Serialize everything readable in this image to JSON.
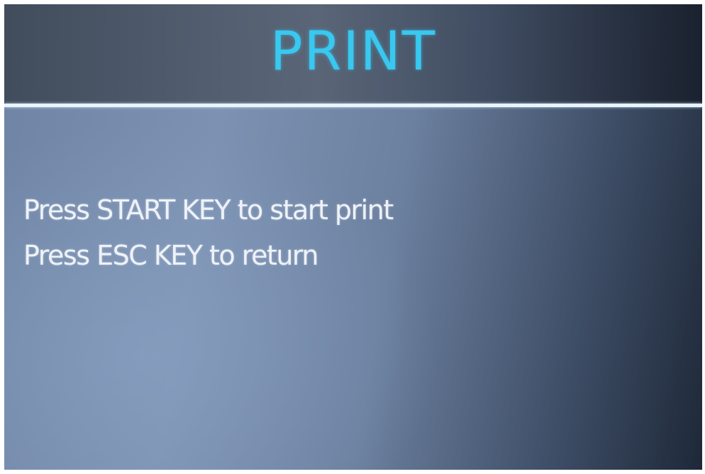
{
  "screen": {
    "title": "PRINT",
    "messages": [
      "Press START KEY to start print",
      "Press ESC KEY to return"
    ]
  },
  "colors": {
    "title": "#38c8f0",
    "text": "#eef2f8",
    "divider": "#e8f4ff"
  }
}
